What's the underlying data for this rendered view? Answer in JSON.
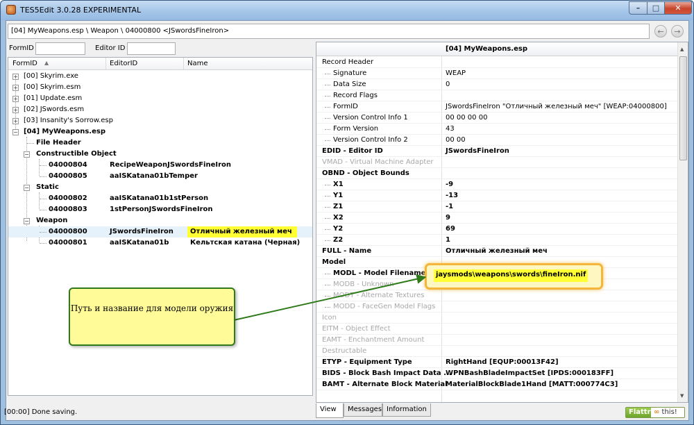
{
  "window": {
    "title": "TES5Edit 3.0.28 EXPERIMENTAL"
  },
  "path": "[04] MyWeapons.esp \\ Weapon \\ 04000800 <JSwordsFineIron>",
  "filters": {
    "formid_label": "FormID",
    "editorid_label": "Editor ID"
  },
  "tree": {
    "headers": {
      "formid": "FormID",
      "editorid": "EditorID",
      "name": "Name"
    },
    "files": [
      "[00] Skyrim.exe",
      "[00] Skyrim.esm",
      "[01] Update.esm",
      "[02] JSwords.esm",
      "[03] Insanity's Sorrow.esp"
    ],
    "open_file": "[04] MyWeapons.esp",
    "file_header": "File Header",
    "groups": [
      {
        "label": "Constructible Object",
        "records": [
          {
            "formid": "04000804",
            "editorid": "RecipeWeaponJSwordsFineIron",
            "name": ""
          },
          {
            "formid": "04000805",
            "editorid": "aaISKatana01bTemper",
            "name": ""
          }
        ]
      },
      {
        "label": "Static",
        "records": [
          {
            "formid": "04000802",
            "editorid": "aaISKatana01b1stPerson",
            "name": ""
          },
          {
            "formid": "04000803",
            "editorid": "1stPersonJSwordsFineIron",
            "name": ""
          }
        ]
      },
      {
        "label": "Weapon",
        "records": [
          {
            "formid": "04000800",
            "editorid": "JSwordsFineIron",
            "name": "Отличный железный меч"
          },
          {
            "formid": "04000801",
            "editorid": "aaISKatana01b",
            "name": "Кельтская катана (Черная)"
          }
        ]
      }
    ]
  },
  "view": {
    "column_header": "[04] MyWeapons.esp",
    "rows": [
      {
        "key": "Record Header",
        "value": ""
      },
      {
        "key": "Signature",
        "value": "WEAP"
      },
      {
        "key": "Data Size",
        "value": "0"
      },
      {
        "key": "Record Flags",
        "value": ""
      },
      {
        "key": "FormID",
        "value": "JSwordsFineIron \"Отличный железный меч\" [WEAP:04000800]"
      },
      {
        "key": "Version Control Info 1",
        "value": "00 00 00 00"
      },
      {
        "key": "Form Version",
        "value": "43"
      },
      {
        "key": "Version Control Info 2",
        "value": "00 00"
      },
      {
        "key": "EDID - Editor ID",
        "value": "JSwordsFineIron"
      },
      {
        "key": "VMAD - Virtual Machine Adapter",
        "value": ""
      },
      {
        "key": "OBND - Object Bounds",
        "value": ""
      },
      {
        "key": "X1",
        "value": "-9"
      },
      {
        "key": "Y1",
        "value": "-13"
      },
      {
        "key": "Z1",
        "value": "-1"
      },
      {
        "key": "X2",
        "value": "9"
      },
      {
        "key": "Y2",
        "value": "69"
      },
      {
        "key": "Z2",
        "value": "1"
      },
      {
        "key": "FULL - Name",
        "value": "Отличный железный меч"
      },
      {
        "key": "Model",
        "value": ""
      },
      {
        "key": "MODL - Model Filename",
        "value": "jaysmods\\weapons\\swords\\fineIron.nif"
      },
      {
        "key": "MODB - Unknown",
        "value": ""
      },
      {
        "key": "MODT - Alternate Textures",
        "value": ""
      },
      {
        "key": "MODD - FaceGen Model Flags",
        "value": ""
      },
      {
        "key": "Icon",
        "value": ""
      },
      {
        "key": "EITM - Object Effect",
        "value": ""
      },
      {
        "key": "EAMT - Enchantment Amount",
        "value": ""
      },
      {
        "key": "Destructable",
        "value": ""
      },
      {
        "key": "ETYP - Equipment Type",
        "value": "RightHand [EQUP:00013F42]"
      },
      {
        "key": "BIDS - Block Bash Impact Data ...",
        "value": "WPNBashBladeImpactSet [IPDS:000183FF]"
      },
      {
        "key": "BAMT - Alternate Block Material",
        "value": "MaterialBlockBlade1Hand [MATT:000774C3]"
      }
    ]
  },
  "tabs": [
    "View",
    "Messages",
    "Information"
  ],
  "status": "[00:00] Done saving.",
  "flattr": {
    "left": "Flattr",
    "right": "this!"
  },
  "callout": "Путь и название для модели оружия",
  "colors": {
    "highlight": "#ffff33",
    "callout_border": "#2f7a1a",
    "callout_fill": "#fffb99"
  }
}
